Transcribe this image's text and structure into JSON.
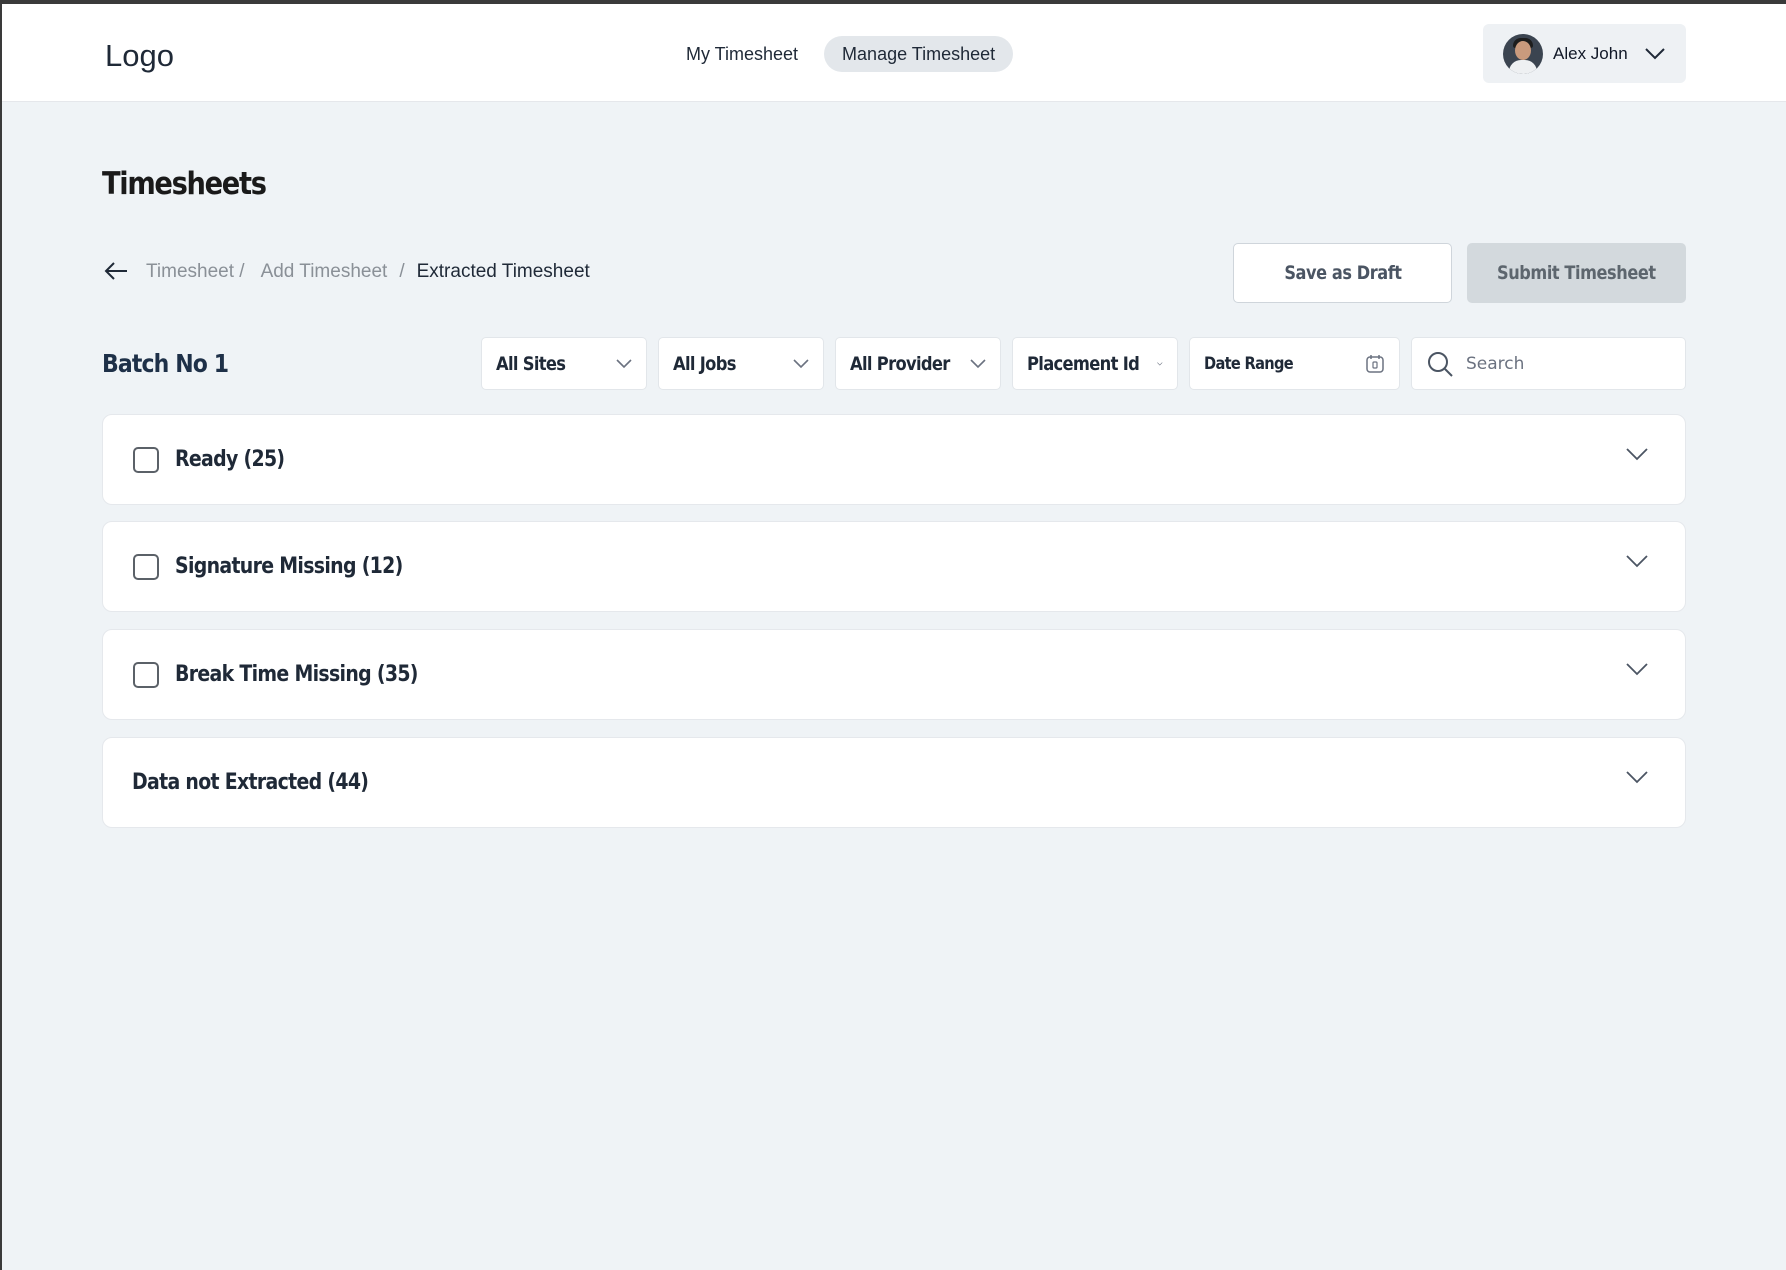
{
  "header": {
    "logo": "Logo",
    "nav": [
      {
        "label": "My Timesheet",
        "active": false
      },
      {
        "label": "Manage Timesheet",
        "active": true
      }
    ],
    "user": {
      "name": "Alex John"
    }
  },
  "page": {
    "title": "Timesheets",
    "breadcrumb": {
      "items": [
        "Timesheet /",
        "Add Timesheet"
      ],
      "separator": "/",
      "current": "Extracted Timesheet"
    },
    "actions": {
      "save_draft": "Save as Draft",
      "submit": "Submit Timesheet"
    }
  },
  "batch": {
    "label": "Batch No 1"
  },
  "filters": {
    "sites": "All Sites",
    "jobs": "All Jobs",
    "provider": "All Provider",
    "placement": "Placement Id",
    "date_range": "Date Range",
    "search_placeholder": "Search"
  },
  "groups": [
    {
      "label": "Ready (25)",
      "checkbox": true
    },
    {
      "label": "Signature Missing (12)",
      "checkbox": true
    },
    {
      "label": "Break Time Missing (35)",
      "checkbox": true
    },
    {
      "label": "Data not Extracted (44)",
      "checkbox": false
    }
  ],
  "colors": {
    "background": "#eff3f6",
    "nav_active": "#e3e7eb",
    "submit_disabled": "#d3d9dd",
    "batch_text": "#1e3048"
  },
  "icons": {
    "back": "arrow-left-icon",
    "dropdown": "chevron-down-icon",
    "calendar": "calendar-icon",
    "search": "search-icon"
  }
}
